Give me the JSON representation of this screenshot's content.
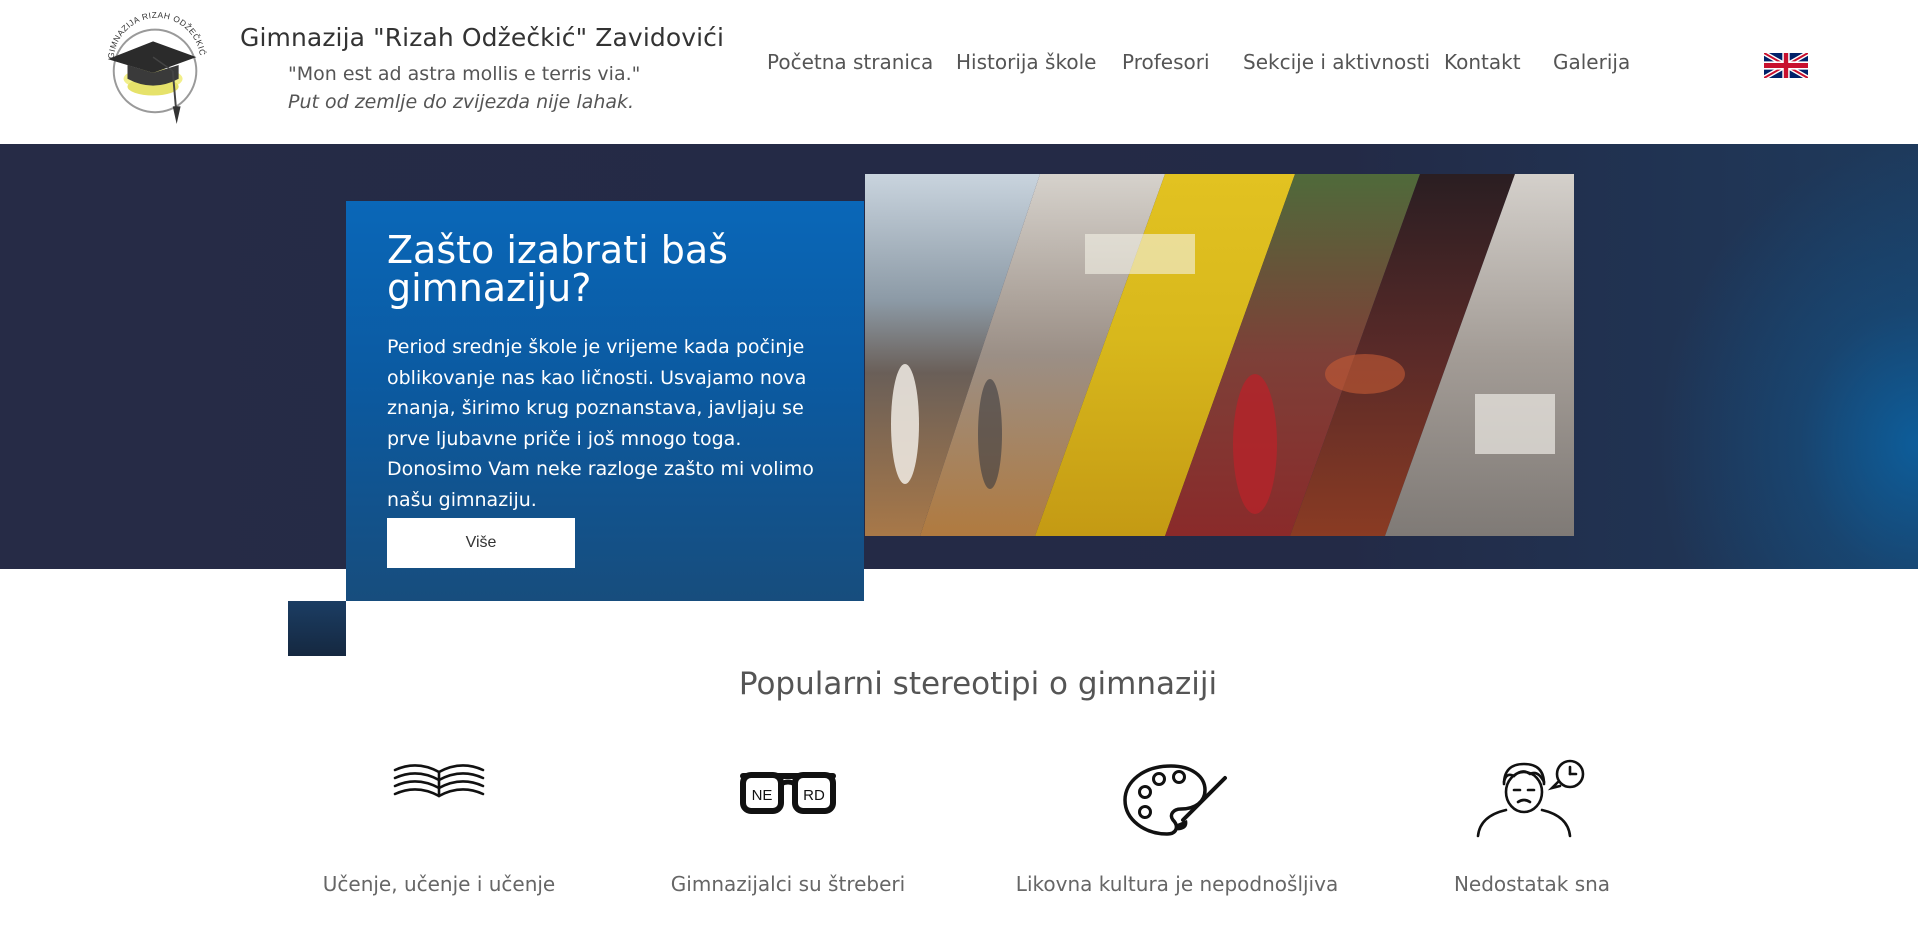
{
  "header": {
    "logo_text": "GIMNAZIJA RIZAH ODŽEČKIĆ",
    "title": "Gimnazija \"Rizah Odžečkić\" Zavidovići",
    "motto_latin": "\"Mon est ad astra mollis e terris via.\"",
    "motto_local": "Put od zemlje do zvijezda nije lahak."
  },
  "nav": {
    "items": [
      {
        "label": "Početna stranica"
      },
      {
        "label": "Historija škole"
      },
      {
        "label": "Profesori"
      },
      {
        "label": "Sekcije i aktivnosti"
      },
      {
        "label": "Kontakt"
      },
      {
        "label": "Galerija"
      }
    ],
    "language_icon": "uk-flag-icon"
  },
  "hero": {
    "title": "Zašto izabrati baš gimnaziju?",
    "text": "Period srednje škole je vrijeme kada počinje oblikovanje nas kao ličnosti. Usvajamo nova znanja, širimo krug poznanstava, javljaju se prve ljubavne priče i još mnogo toga. Donosimo Vam neke razloge zašto mi volimo našu gimnaziju.",
    "button_label": "Više"
  },
  "stereotypes": {
    "title": "Popularni stereotipi o gimnaziji",
    "items": [
      {
        "icon": "open-book-icon",
        "label": "Učenje, učenje i učenje"
      },
      {
        "icon": "nerd-glasses-icon",
        "label": "Gimnazijalci su štreberi",
        "glasses_left": "NE",
        "glasses_right": "RD"
      },
      {
        "icon": "paint-palette-icon",
        "label": "Likovna kultura je nepodnošljiva"
      },
      {
        "icon": "tired-person-clock-icon",
        "label": "Nedostatak sna"
      }
    ]
  },
  "colors": {
    "hero_background": "#262b46",
    "hero_card": "#0a67b8",
    "text_primary": "#333333"
  }
}
